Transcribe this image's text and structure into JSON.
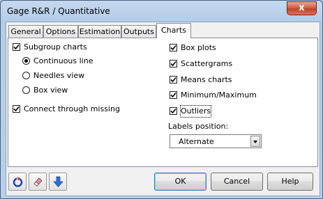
{
  "window": {
    "title": "Gage R&R / Quantitative",
    "close_glyph": "x"
  },
  "tabs": [
    {
      "label": "General",
      "active": false
    },
    {
      "label": "Options",
      "active": false
    },
    {
      "label": "Estimation",
      "active": false
    },
    {
      "label": "Outputs",
      "active": false
    },
    {
      "label": "Charts",
      "active": true
    }
  ],
  "charts": {
    "subgroup_charts": {
      "label": "Subgroup charts",
      "checked": true
    },
    "subgroup_style": {
      "selected": "Continuous line",
      "options": [
        "Continuous line",
        "Needles view",
        "Box view"
      ]
    },
    "connect_missing": {
      "label": "Connect through missing",
      "checked": true
    },
    "box_plots": {
      "label": "Box plots",
      "checked": true
    },
    "scattergrams": {
      "label": "Scattergrams",
      "checked": true
    },
    "means_charts": {
      "label": "Means charts",
      "checked": true
    },
    "min_max": {
      "label": "Minimum/Maximum",
      "checked": true
    },
    "outliers": {
      "label": "Outliers",
      "checked": true
    },
    "labels_position": {
      "label": "Labels position:",
      "value": "Alternate"
    }
  },
  "footer": {
    "icons": [
      "reset-icon",
      "eraser-icon",
      "download-arrow-icon"
    ],
    "ok_label": "OK",
    "cancel_label": "Cancel",
    "help_label": "Help"
  },
  "colors": {
    "title_bar": "#b3cde8",
    "close_button": "#c4412a",
    "default_button_border": "#3c7fb1"
  }
}
